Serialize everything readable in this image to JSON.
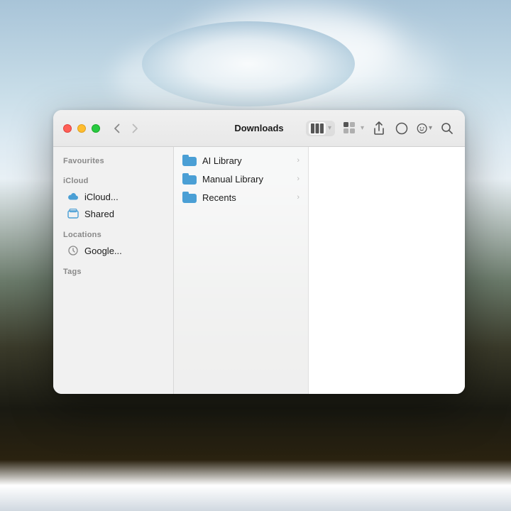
{
  "desktop": {
    "bg_description": "macOS desktop with sky and ocean landscape"
  },
  "window": {
    "title": "Downloads",
    "traffic_lights": {
      "close_label": "close",
      "minimize_label": "minimize",
      "maximize_label": "maximize"
    }
  },
  "toolbar": {
    "back_label": "‹",
    "forward_label": "›",
    "title": "Downloads",
    "view_columns_label": "columns",
    "view_grid_label": "grid",
    "share_label": "share",
    "tag_label": "tag",
    "action_label": "action",
    "search_label": "search"
  },
  "sidebar": {
    "sections": [
      {
        "id": "favourites",
        "label": "Favourites",
        "items": []
      },
      {
        "id": "icloud",
        "label": "iCloud",
        "items": [
          {
            "id": "icloud-drive",
            "label": "iCloud...",
            "icon": "icloud"
          },
          {
            "id": "shared",
            "label": "Shared",
            "icon": "shared"
          }
        ]
      },
      {
        "id": "locations",
        "label": "Locations",
        "items": [
          {
            "id": "google",
            "label": "Google...",
            "icon": "google"
          }
        ]
      },
      {
        "id": "tags",
        "label": "Tags",
        "items": []
      }
    ]
  },
  "files": [
    {
      "id": "ai-library",
      "name": "AI Library",
      "type": "folder"
    },
    {
      "id": "manual-library",
      "name": "Manual Library",
      "type": "folder"
    },
    {
      "id": "recents",
      "name": "Recents",
      "type": "folder"
    }
  ]
}
